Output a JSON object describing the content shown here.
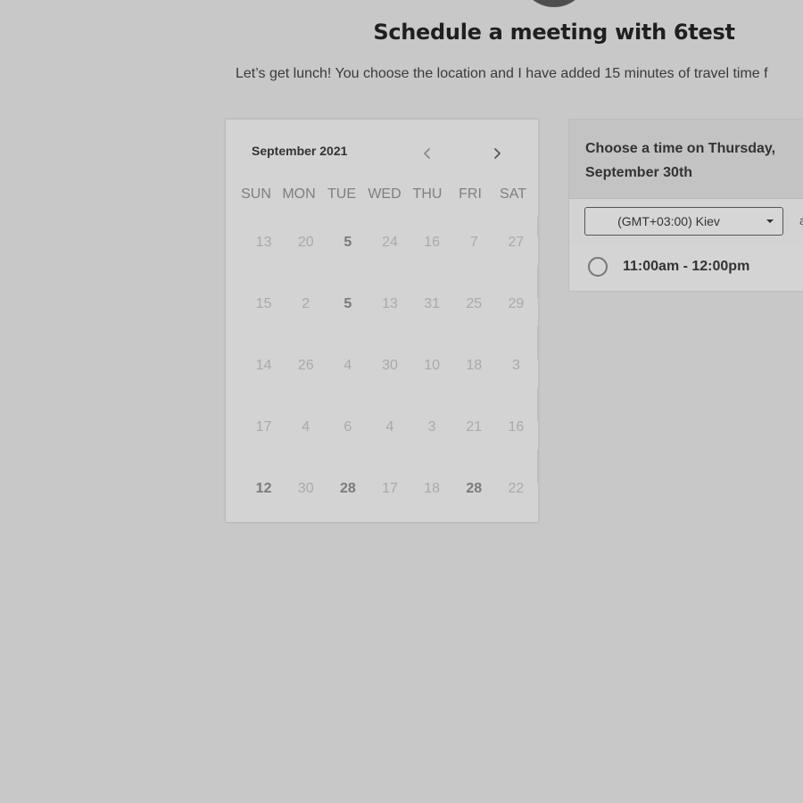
{
  "header": {
    "title": "Schedule a meeting with 6test",
    "subtitle": "Let’s get lunch! You choose the location and I have added 15 minutes of travel time f"
  },
  "calendar": {
    "month_label": "September 2021",
    "days_of_week": [
      "SUN",
      "MON",
      "TUE",
      "WED",
      "THU",
      "FRI",
      "SAT"
    ],
    "weeks": [
      [
        {
          "d": "13",
          "a": false
        },
        {
          "d": "20",
          "a": false
        },
        {
          "d": "5",
          "a": true
        },
        {
          "d": "24",
          "a": false
        },
        {
          "d": "16",
          "a": false
        },
        {
          "d": "7",
          "a": false
        },
        {
          "d": "27",
          "a": false
        }
      ],
      [
        {
          "d": "15",
          "a": false
        },
        {
          "d": "2",
          "a": false
        },
        {
          "d": "5",
          "a": true
        },
        {
          "d": "13",
          "a": false
        },
        {
          "d": "31",
          "a": false
        },
        {
          "d": "25",
          "a": false
        },
        {
          "d": "29",
          "a": false
        }
      ],
      [
        {
          "d": "14",
          "a": false
        },
        {
          "d": "26",
          "a": false
        },
        {
          "d": "4",
          "a": false
        },
        {
          "d": "30",
          "a": false
        },
        {
          "d": "10",
          "a": false
        },
        {
          "d": "18",
          "a": false
        },
        {
          "d": "3",
          "a": false
        }
      ],
      [
        {
          "d": "17",
          "a": false
        },
        {
          "d": "4",
          "a": false
        },
        {
          "d": "6",
          "a": false
        },
        {
          "d": "4",
          "a": false
        },
        {
          "d": "3",
          "a": false
        },
        {
          "d": "21",
          "a": false
        },
        {
          "d": "16",
          "a": false
        }
      ],
      [
        {
          "d": "12",
          "a": true
        },
        {
          "d": "30",
          "a": false
        },
        {
          "d": "28",
          "a": true
        },
        {
          "d": "17",
          "a": false
        },
        {
          "d": "18",
          "a": false
        },
        {
          "d": "28",
          "a": true
        },
        {
          "d": "22",
          "a": false
        }
      ]
    ]
  },
  "time_panel": {
    "heading": "Choose a time on Thursday, September 30th",
    "timezone": "(GMT+03:00) Kiev",
    "aside": "a",
    "slots": [
      {
        "label": "11:00am - 12:00pm",
        "selected": false
      }
    ]
  },
  "colors": {
    "background": "#c8c8c8",
    "panel": "#d3d3d3",
    "panel_header": "#c3c3c3",
    "avatar": "#4e4e4e"
  }
}
